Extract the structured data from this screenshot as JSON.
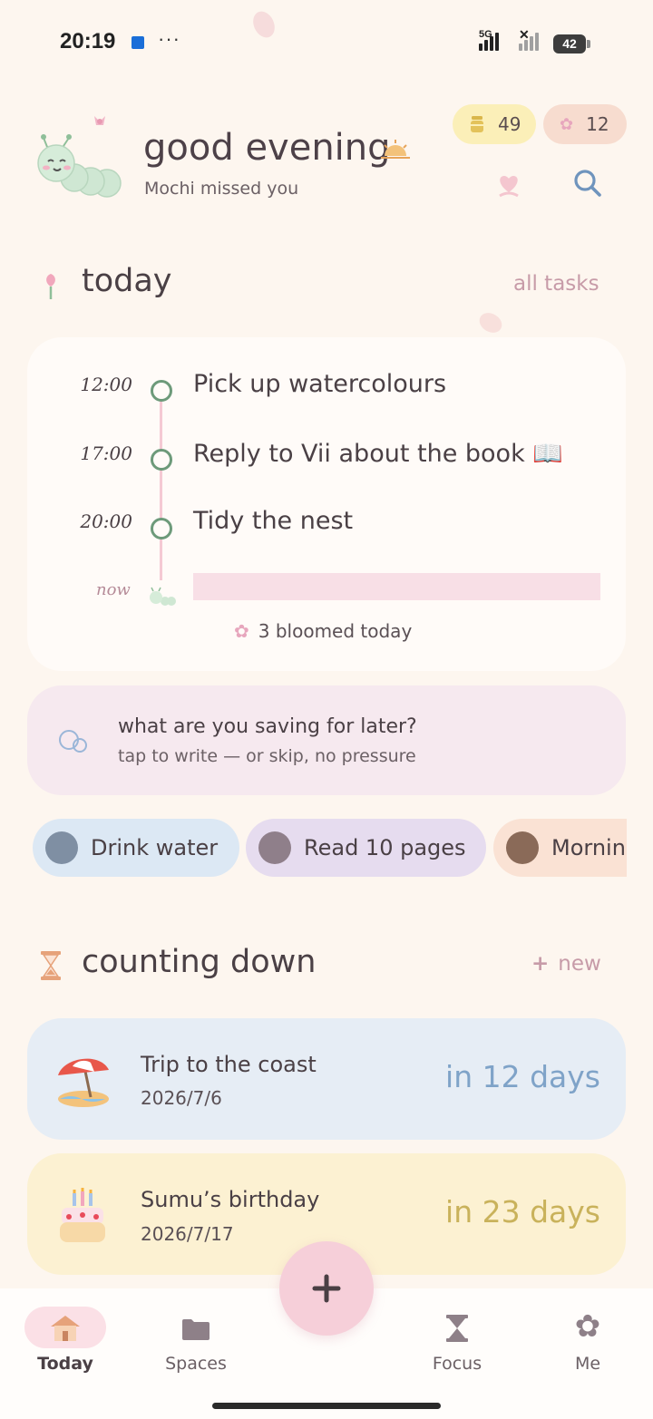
{
  "status": {
    "time": "20:19",
    "dots": "···",
    "network": "5G",
    "battery": "42"
  },
  "currencies": [
    {
      "icon": "honey-jar-icon",
      "value": "49"
    },
    {
      "icon": "blossom-icon",
      "value": "12"
    }
  ],
  "header": {
    "greeting": "good evening",
    "subtitle": "Mochi missed you"
  },
  "today": {
    "title": "today",
    "link": "all tasks",
    "tasks": [
      {
        "time": "12:00",
        "title": "Pick up watercolours"
      },
      {
        "time": "17:00",
        "title": "Reply to Vii about the book 📖"
      },
      {
        "time": "20:00",
        "title": "Tidy the nest"
      }
    ],
    "now_label": "now",
    "bloomed": "3 bloomed today"
  },
  "prompt": {
    "question": "what are you saving for later?",
    "hint": "tap to write — or skip, no pressure"
  },
  "habits": [
    {
      "label": "Drink water",
      "color": "#dce8f4"
    },
    {
      "label": "Read 10 pages",
      "color": "#e6dcef"
    },
    {
      "label": "Morning",
      "color": "#fae2d4"
    }
  ],
  "countdown": {
    "title": "counting down",
    "new_label": "new",
    "items": [
      {
        "name": "Trip to the coast",
        "date": "2026/7/6",
        "days": "in 12 days",
        "bg": "#e6edf5",
        "accent": "#7fa3c8"
      },
      {
        "name": "Sumu’s birthday",
        "date": "2026/7/17",
        "days": "in 23 days",
        "bg": "#fcf1d2",
        "accent": "#c9b25b"
      }
    ]
  },
  "nav": [
    {
      "label": "Today",
      "icon": "house-icon",
      "active": true
    },
    {
      "label": "Spaces",
      "icon": "folder-icon",
      "active": false
    },
    {
      "label": "Focus",
      "icon": "hourglass-icon",
      "active": false
    },
    {
      "label": "Me",
      "icon": "flower-icon",
      "active": false
    }
  ]
}
